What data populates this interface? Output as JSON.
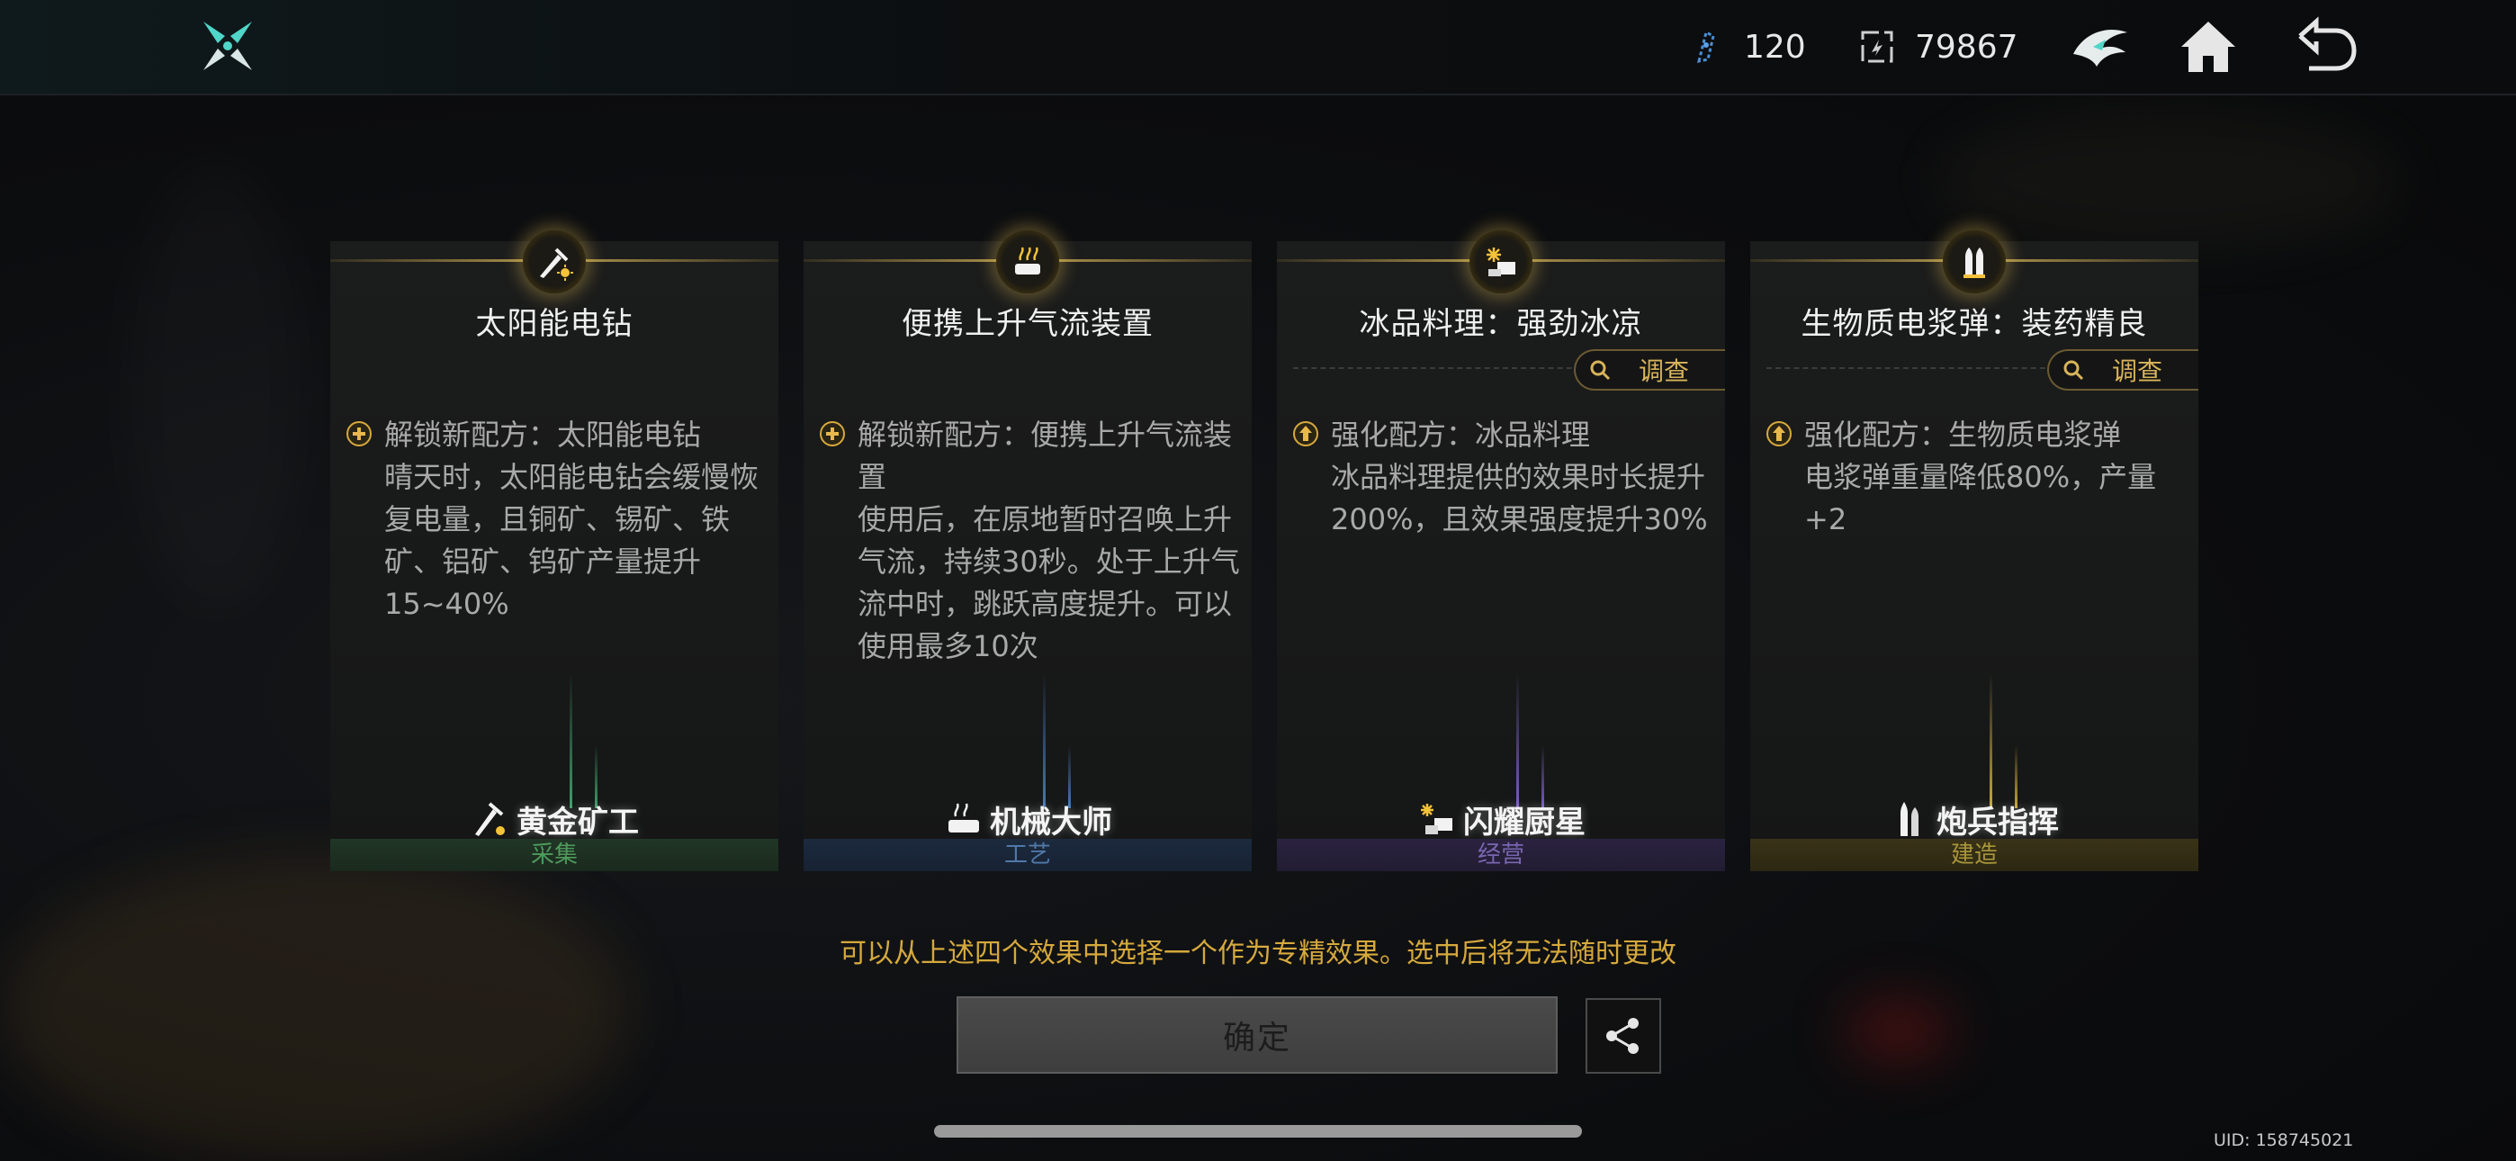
{
  "topbar": {
    "currency1": {
      "icon": "crystal-shard-icon",
      "value": "120"
    },
    "currency2": {
      "icon": "chip-token-icon",
      "value": "79867"
    },
    "buttons": [
      "faction-emblem-icon",
      "home-icon",
      "back-arrow-icon"
    ]
  },
  "cards": [
    {
      "title": "太阳能电钻",
      "medal_icon": "solar-drill-icon",
      "has_investigate": false,
      "effect_type_icon": "unlock-plus-icon",
      "effect_head": "解锁新配方：太阳能电钻",
      "effect_body": "晴天时，太阳能电钻会缓慢恢复电量，且铜矿、锡矿、铁矿、铝矿、钨矿产量提升15~40%",
      "profession": "黄金矿工",
      "profession_icon": "golden-miner-icon",
      "category": "采集",
      "accent": "#3f7a45"
    },
    {
      "title": "便携上升气流装置",
      "medal_icon": "updraft-device-icon",
      "has_investigate": false,
      "effect_type_icon": "unlock-plus-icon",
      "effect_head": "解锁新配方：便携上升气流装置",
      "effect_body": "使用后，在原地暂时召唤上升气流，持续30秒。处于上升气流中时，跳跃高度提升。可以使用最多10次",
      "profession": "机械大师",
      "profession_icon": "mechanic-master-icon",
      "category": "工艺",
      "accent": "#3e5f8c"
    },
    {
      "title": "冰品料理：强劲冰凉",
      "medal_icon": "ice-dish-icon",
      "has_investigate": true,
      "investigate_label": "调查",
      "effect_type_icon": "upgrade-arrow-icon",
      "effect_head": "强化配方：冰品料理",
      "effect_body": "冰品料理提供的效果时长提升200%，且效果强度提升30%",
      "profession": "闪耀厨星",
      "profession_icon": "shining-chef-icon",
      "category": "经营",
      "accent": "#5e4a8a"
    },
    {
      "title": "生物质电浆弹：装药精良",
      "medal_icon": "plasma-shell-icon",
      "has_investigate": true,
      "investigate_label": "调查",
      "effect_type_icon": "upgrade-arrow-icon",
      "effect_head": "强化配方：生物质电浆弹",
      "effect_body": "电浆弹重量降低80%，产量+2",
      "profession": "炮兵指挥",
      "profession_icon": "artillery-commander-icon",
      "category": "建造",
      "accent": "#8c7a30"
    }
  ],
  "notice": "可以从上述四个效果中选择一个作为专精效果。选中后将无法随时更改",
  "confirm_label": "确定",
  "uid": "UID: 158745021"
}
